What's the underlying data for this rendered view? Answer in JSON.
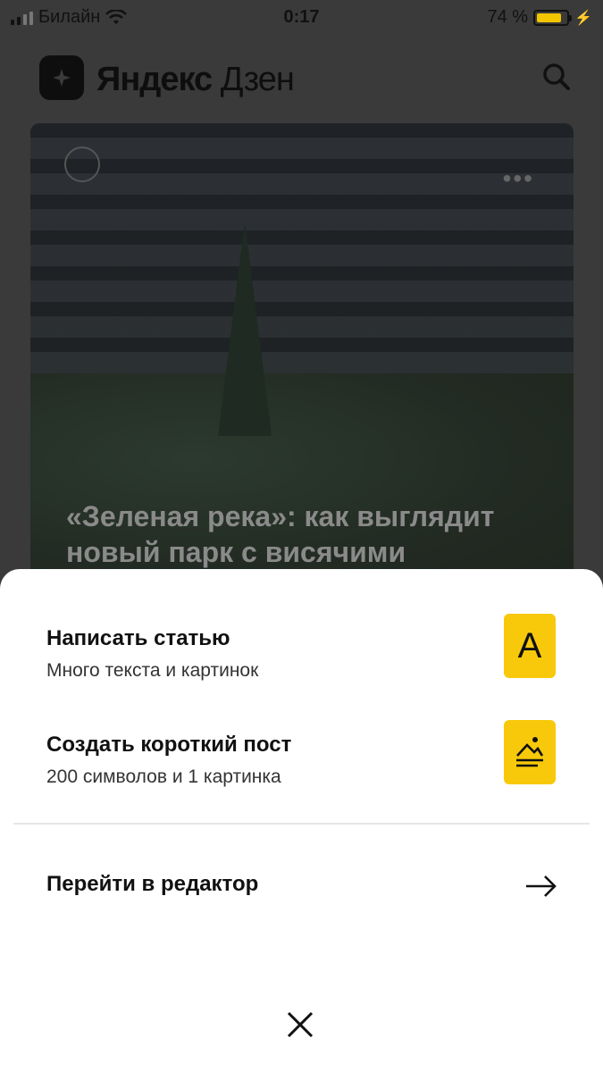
{
  "status": {
    "carrier": "Билайн",
    "time": "0:17",
    "battery_text": "74 %",
    "battery_level": 0.74
  },
  "header": {
    "brand_bold": "Яндекс",
    "brand_light": " Дзен"
  },
  "card": {
    "title": "«Зеленая река»: как выглядит новый парк с висячими"
  },
  "sheet": {
    "options": [
      {
        "title": "Написать статью",
        "subtitle": "Много текста и картинок",
        "badge": "A"
      },
      {
        "title": "Создать короткий пост",
        "subtitle": "200 символов и 1 картинка",
        "badge_icon": "post-icon"
      }
    ],
    "editor_label": "Перейти в редактор"
  },
  "colors": {
    "accent": "#f8c90a",
    "overlay": "#3a3a3a"
  }
}
